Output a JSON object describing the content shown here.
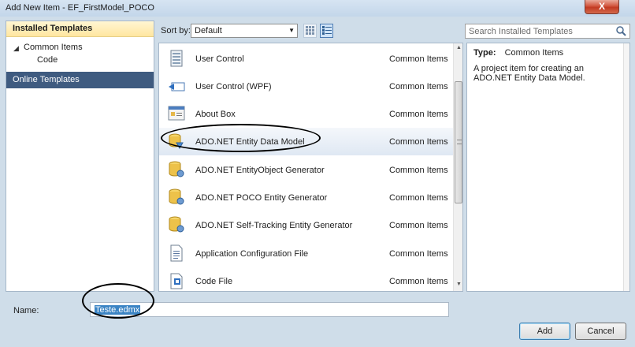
{
  "window": {
    "title": "Add New Item - EF_FirstModel_POCO",
    "close_glyph": "X"
  },
  "left_panel": {
    "installed_header": "Installed Templates",
    "tree": [
      {
        "label": "Common Items",
        "expanded": true,
        "arrow": "◢"
      },
      {
        "label": "Code"
      }
    ],
    "online_header": "Online Templates"
  },
  "toolbar": {
    "sort_label": "Sort by:",
    "sort_value": "Default"
  },
  "search": {
    "placeholder": "Search Installed Templates"
  },
  "templates": [
    {
      "name": "User Control",
      "category": "Common Items",
      "icon": "user-control-icon"
    },
    {
      "name": "User Control (WPF)",
      "category": "Common Items",
      "icon": "wpf-control-icon"
    },
    {
      "name": "About Box",
      "category": "Common Items",
      "icon": "about-box-icon"
    },
    {
      "name": "ADO.NET Entity Data Model",
      "category": "Common Items",
      "icon": "entity-model-icon",
      "selected": true
    },
    {
      "name": "ADO.NET EntityObject Generator",
      "category": "Common Items",
      "icon": "database-icon"
    },
    {
      "name": "ADO.NET POCO Entity Generator",
      "category": "Common Items",
      "icon": "database-icon"
    },
    {
      "name": "ADO.NET Self-Tracking Entity Generator",
      "category": "Common Items",
      "icon": "database-icon"
    },
    {
      "name": "Application Configuration File",
      "category": "Common Items",
      "icon": "config-file-icon"
    },
    {
      "name": "Code File",
      "category": "Common Items",
      "icon": "code-file-icon"
    }
  ],
  "details": {
    "type_label": "Type:",
    "type_value": "Common Items",
    "description": "A project item for creating an ADO.NET Entity Data Model."
  },
  "bottom": {
    "name_label": "Name:",
    "name_value": "Teste.edmx",
    "add_label": "Add",
    "cancel_label": "Cancel"
  },
  "colors": {
    "selected_header": "#ffe6a0",
    "online_header": "#3f5b80",
    "input_selection": "#3b84c4"
  }
}
